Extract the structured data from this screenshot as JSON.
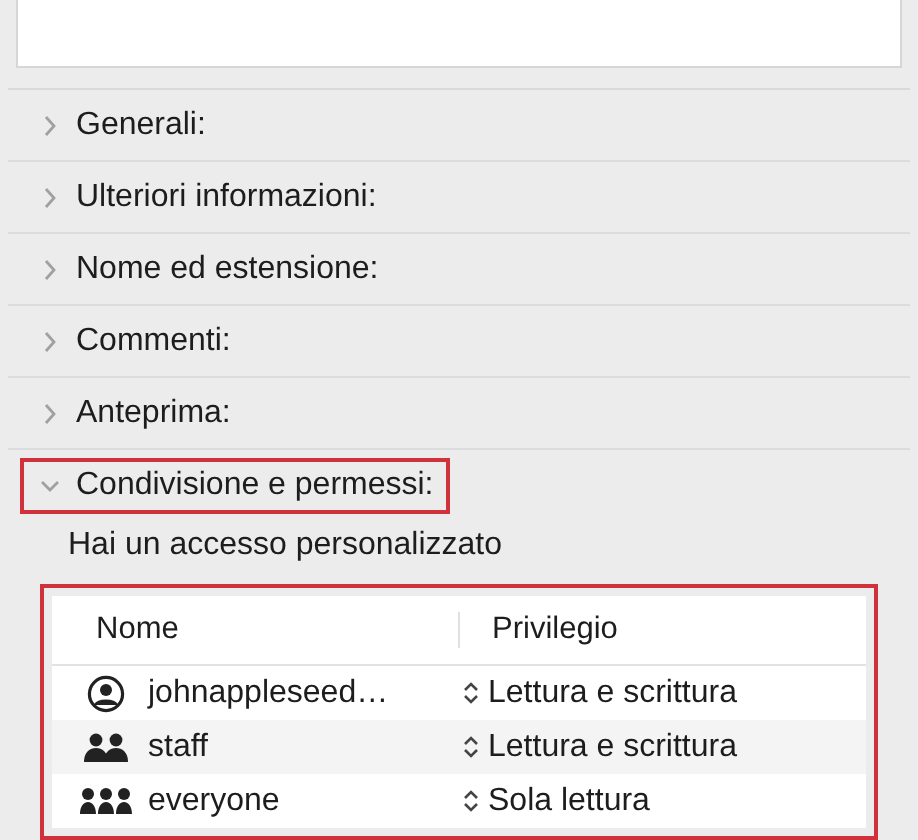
{
  "comment_field": {
    "kind": "textarea"
  },
  "sections": [
    {
      "title": "Generali:",
      "expanded": false,
      "highlighted": false
    },
    {
      "title": "Ulteriori informazioni:",
      "expanded": false,
      "highlighted": false
    },
    {
      "title": "Nome ed estensione:",
      "expanded": false,
      "highlighted": false
    },
    {
      "title": "Commenti:",
      "expanded": false,
      "highlighted": false
    },
    {
      "title": "Anteprima:",
      "expanded": false,
      "highlighted": false
    },
    {
      "title": "Condivisione e permessi:",
      "expanded": true,
      "highlighted": true
    }
  ],
  "sharing": {
    "status": "Hai un accesso personalizzato",
    "table_highlighted": true,
    "columns": [
      "Nome",
      "Privilegio"
    ],
    "rows": [
      {
        "kind": "user",
        "name": "johnappleseed…",
        "privilege": "Lettura e scrittura"
      },
      {
        "kind": "group",
        "name": "staff",
        "privilege": "Lettura e scrittura"
      },
      {
        "kind": "everyone",
        "name": "everyone",
        "privilege": "Sola lettura"
      }
    ]
  }
}
